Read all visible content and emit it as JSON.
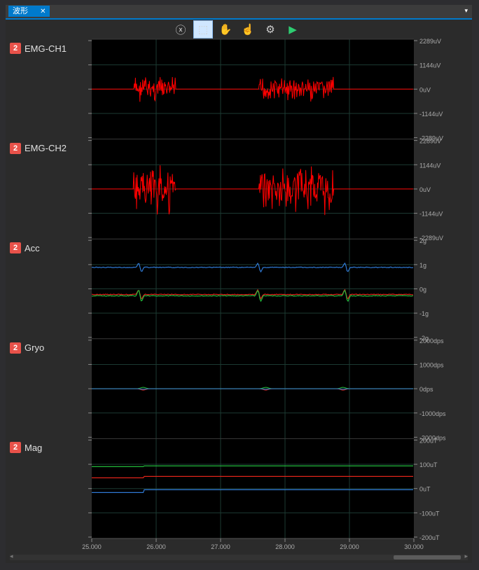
{
  "window": {
    "tab_title": "波形",
    "tab_close": "✕",
    "menu_arrow": "▾"
  },
  "toolbar": {
    "buttons": [
      {
        "name": "reset-zoom",
        "icon": "ⓧ",
        "active": false
      },
      {
        "name": "select",
        "icon": "⬚",
        "active": true
      },
      {
        "name": "pan-hand",
        "icon": "✋",
        "active": false
      },
      {
        "name": "point-hand",
        "icon": "☝",
        "active": false
      },
      {
        "name": "settings",
        "icon": "⚙",
        "active": false
      },
      {
        "name": "play",
        "icon": "▶",
        "active": false
      }
    ]
  },
  "colors": {
    "emg": "#ff0000",
    "axis_x": "#e0241a",
    "axis_y": "#22b83a",
    "axis_z": "#2f79d4",
    "grid": "#1c3a32",
    "plot_bg": "#000000",
    "play": "#2ecc71",
    "badge": "#e8524a"
  },
  "channels": [
    {
      "badge": "2",
      "name": "EMG-CH1",
      "ticks": [
        "2289uV",
        "1144uV",
        "0uV",
        "-1144uV",
        "-2289uV"
      ]
    },
    {
      "badge": "2",
      "name": "EMG-CH2",
      "ticks": [
        "2289uV",
        "1144uV",
        "0uV",
        "-1144uV",
        "-2289uV"
      ]
    },
    {
      "badge": "2",
      "name": "Acc",
      "ticks": [
        "2g",
        "1g",
        "0g",
        "-1g",
        "-2g"
      ]
    },
    {
      "badge": "2",
      "name": "Gryo",
      "ticks": [
        "2000dps",
        "1000dps",
        "0dps",
        "-1000dps",
        "-2000dps"
      ]
    },
    {
      "badge": "2",
      "name": "Mag",
      "ticks": [
        "200uT",
        "100uT",
        "0uT",
        "-100uT",
        "-200uT"
      ]
    }
  ],
  "x_axis": {
    "ticks": [
      "25.000",
      "26.000",
      "27.000",
      "28.000",
      "29.000",
      "30.000"
    ],
    "range": [
      25,
      30
    ]
  },
  "scrollbar": {
    "left_arrow": "◂",
    "right_arrow": "▸"
  }
}
